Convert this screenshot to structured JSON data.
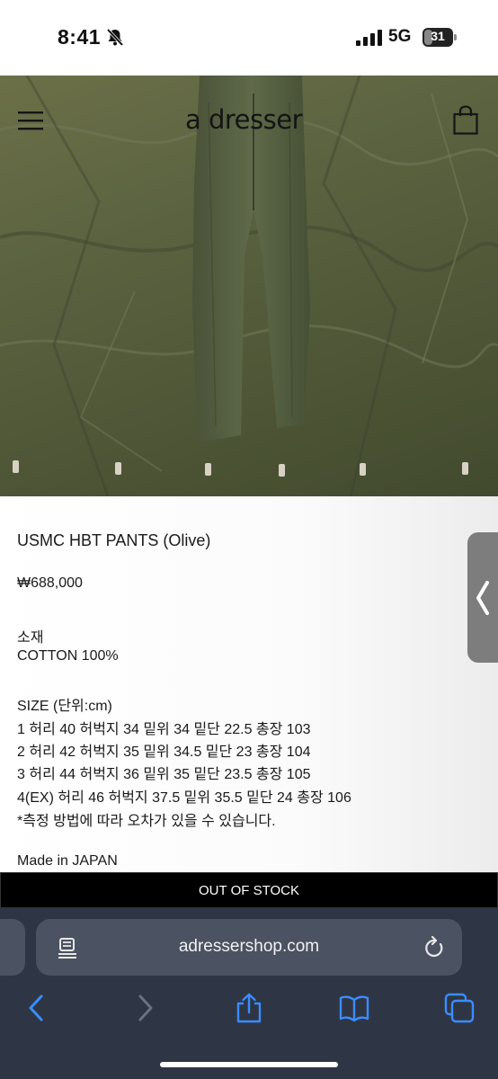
{
  "status_bar": {
    "time": "8:41",
    "network": "5G",
    "battery_level": "31",
    "battery_fraction": 0.31,
    "icons": [
      "bell-slash-icon",
      "signal-bars-icon"
    ]
  },
  "site_header": {
    "brand": "a dresser",
    "menu_icon": "hamburger-menu-icon",
    "cart_icon": "shopping-bag-icon"
  },
  "product": {
    "title": "USMC HBT PANTS (Olive)",
    "price": "₩688,000",
    "material_label": "소재",
    "material_value": "COTTON 100%",
    "size_heading": "SIZE (단위:cm)",
    "sizes": [
      "1 허리 40 허벅지 34 밑위 34 밑단 22.5 총장 103",
      "2 허리 42 허벅지 35 밑위 34.5 밑단 23 총장 104",
      "3 허리 44 허벅지 36 밑위 35 밑단 23.5 총장 105",
      "4(EX) 허리 46 허벅지 37.5 밑위 35.5 밑단 24 총장 106"
    ],
    "size_note": "*측정 방법에 따라 오차가 있을 수 있습니다.",
    "origin": "Made in JAPAN",
    "stock_button": "OUT OF STOCK"
  },
  "side_tab": {
    "icon": "chevron-left-icon"
  },
  "browser": {
    "url": "adressershop.com",
    "icons": [
      "reader-mode-icon",
      "reload-icon",
      "back-icon",
      "forward-icon",
      "share-icon",
      "bookmarks-icon",
      "tabs-icon"
    ]
  },
  "colors": {
    "olive_background": "#5b6240",
    "button_bg": "#000000",
    "browser_bg": "#2e3645",
    "accent_blue": "#3b8cff"
  }
}
